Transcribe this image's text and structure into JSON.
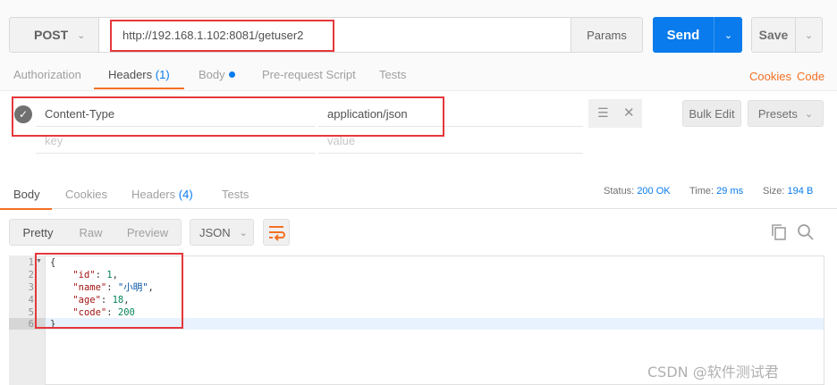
{
  "request": {
    "method": "POST",
    "url": "http://192.168.1.102:8081/getuser2",
    "params_label": "Params",
    "send_label": "Send",
    "save_label": "Save"
  },
  "request_tabs": {
    "authorization": "Authorization",
    "headers": "Headers",
    "headers_count": "(1)",
    "body": "Body",
    "prerequest": "Pre-request Script",
    "tests": "Tests",
    "cookies": "Cookies",
    "code": "Code"
  },
  "headers": {
    "row_key": "Content-Type",
    "row_value": "application/json",
    "key_placeholder": "key",
    "value_placeholder": "value",
    "bulk_edit": "Bulk Edit",
    "presets": "Presets"
  },
  "response_tabs": {
    "body": "Body",
    "cookies": "Cookies",
    "headers": "Headers",
    "headers_count": "(4)",
    "tests": "Tests"
  },
  "status": {
    "status_label": "Status:",
    "status_value": "200 OK",
    "time_label": "Time:",
    "time_value": "29 ms",
    "size_label": "Size:",
    "size_value": "194 B"
  },
  "format": {
    "pretty": "Pretty",
    "raw": "Raw",
    "preview": "Preview",
    "json": "JSON"
  },
  "response_body": {
    "line_numbers": [
      "1",
      "2",
      "3",
      "4",
      "5",
      "6"
    ],
    "open_brace": "{",
    "id_key": "\"id\"",
    "id_value": "1",
    "name_key": "\"name\"",
    "name_value": "\"小明\"",
    "age_key": "\"age\"",
    "age_value": "18",
    "code_key": "\"code\"",
    "code_value": "200",
    "close_brace": "}"
  },
  "watermark": "CSDN @软件测试君",
  "colors": {
    "send_blue": "#097bed",
    "accent_orange": "#f47023",
    "highlight_red": "#e5373b"
  }
}
